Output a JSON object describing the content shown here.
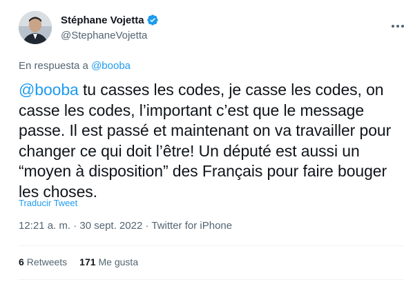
{
  "author": {
    "display_name": "Stéphane Vojetta",
    "handle": "@StephaneVojetta",
    "verified": true
  },
  "reply": {
    "prefix": "En respuesta a",
    "mention": "@booba"
  },
  "tweet": {
    "mention": "@booba",
    "text": " tu casses les codes, je casse les codes, on casse les codes, l’important c’est que le message passe. Il est passé et maintenant on va travailler pour changer ce qui doit l’être! Un député est aussi un “moyen à disposition” des Français pour faire bouger les choses."
  },
  "translate_label": "Traducir Tweet",
  "meta": {
    "time": "12:21 a. m.",
    "separator1": " · ",
    "date": "30 sept. 2022",
    "separator2": " · ",
    "source": "Twitter for iPhone"
  },
  "stats": {
    "retweets_count": "6",
    "retweets_label": "Retweets",
    "likes_count": "171",
    "likes_label": "Me gusta"
  },
  "colors": {
    "accent": "#1d9bf0",
    "secondary_text": "#536471",
    "primary_text": "#0f1419"
  },
  "icons": [
    "verified-badge-icon",
    "more-options-icon"
  ]
}
